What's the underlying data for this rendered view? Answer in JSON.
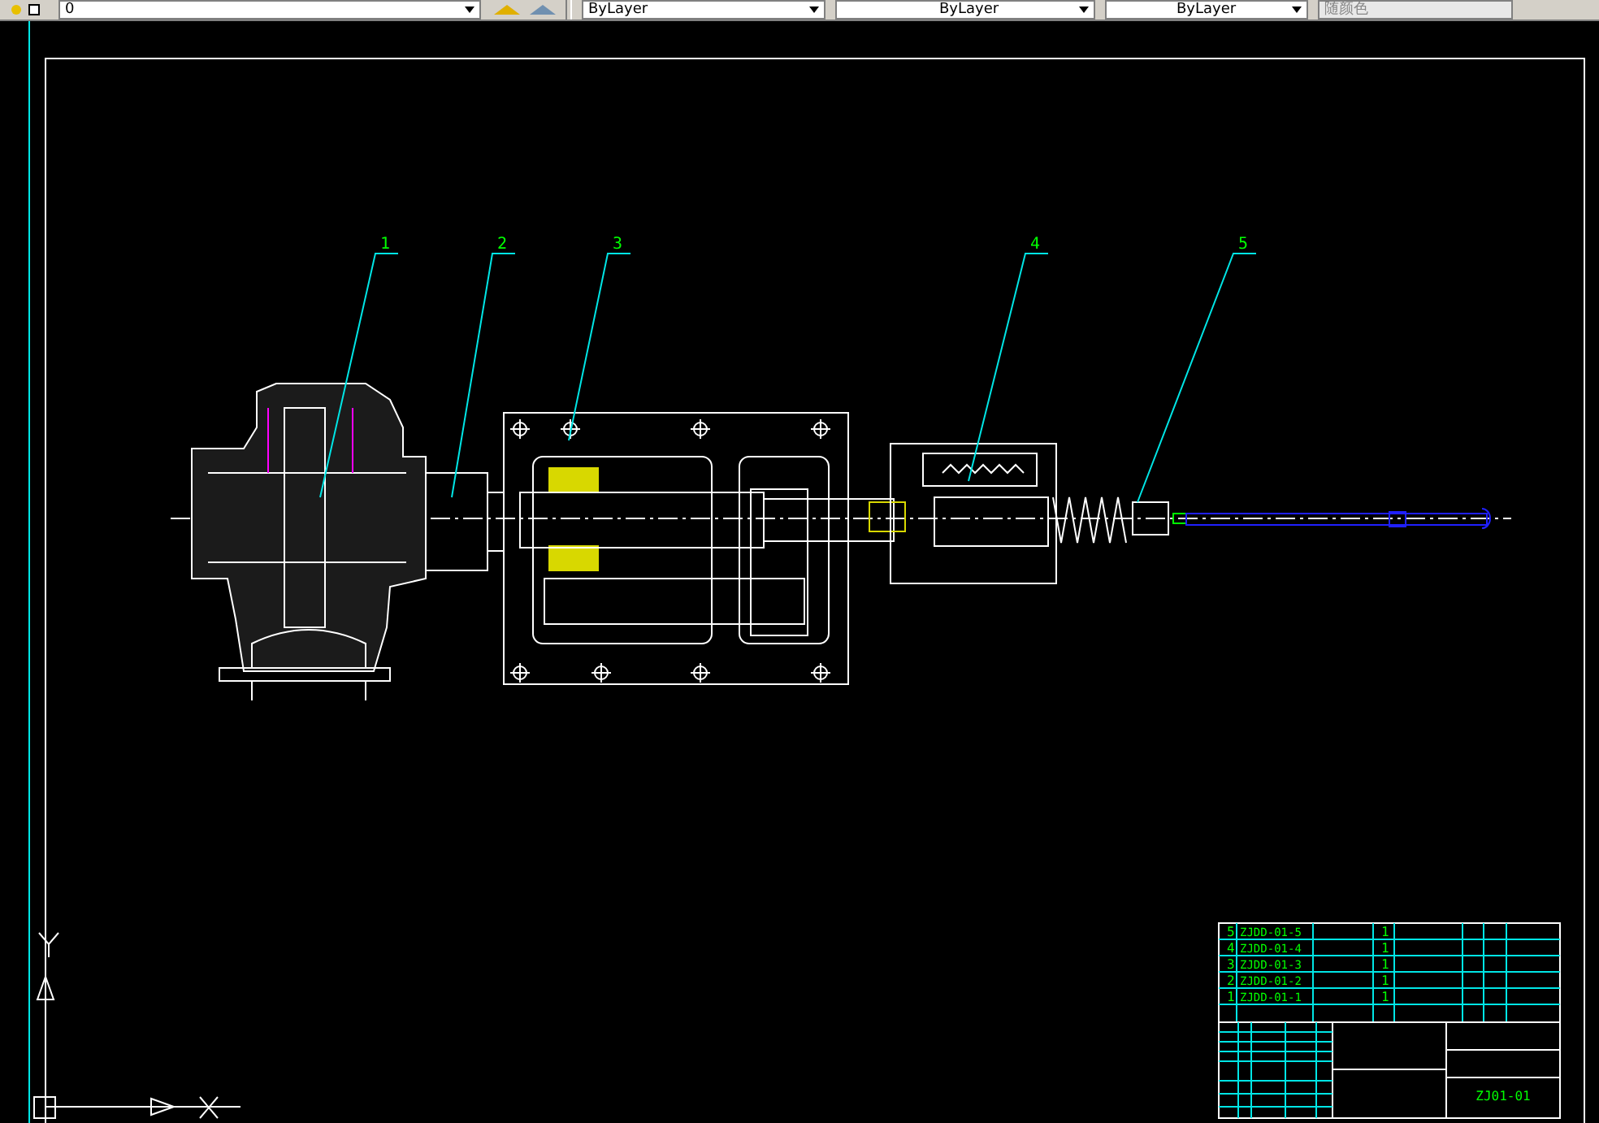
{
  "toolbar": {
    "layer": "0",
    "color_control": "ByLayer",
    "linetype": "ByLayer",
    "lineweight": "ByLayer",
    "plot_style": "随颜色"
  },
  "balloons": [
    {
      "label": "1"
    },
    {
      "label": "2"
    },
    {
      "label": "3"
    },
    {
      "label": "4"
    },
    {
      "label": "5"
    }
  ],
  "title_block": {
    "parts": [
      {
        "no": "5",
        "code": "ZJDD-01-5",
        "qty": "1"
      },
      {
        "no": "4",
        "code": "ZJDD-01-4",
        "qty": "1"
      },
      {
        "no": "3",
        "code": "ZJDD-01-3",
        "qty": "1"
      },
      {
        "no": "2",
        "code": "ZJDD-01-2",
        "qty": "1"
      },
      {
        "no": "1",
        "code": "ZJDD-01-1",
        "qty": "1"
      }
    ],
    "drawing_number": "ZJ01-01"
  }
}
